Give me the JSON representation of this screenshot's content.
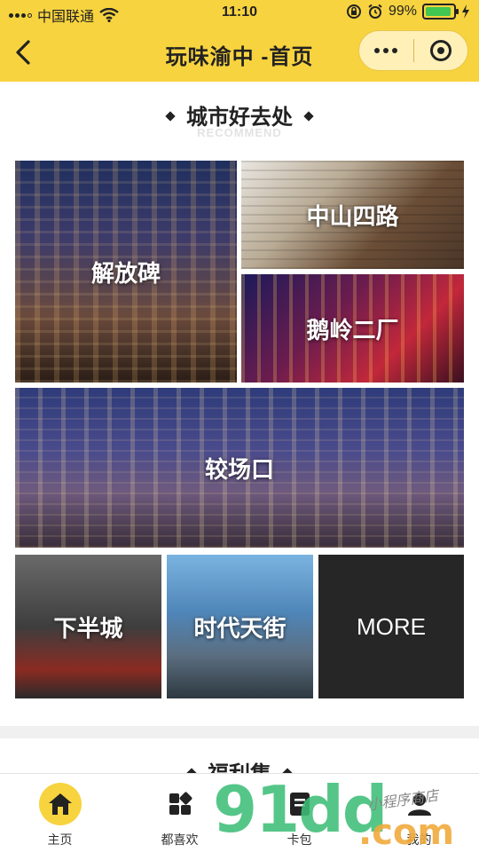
{
  "status_bar": {
    "carrier": "中国联通",
    "time": "11:10",
    "battery": "99%"
  },
  "nav": {
    "title": "玩味渝中 -首页"
  },
  "section1": {
    "title": "城市好去处",
    "subtitle": "RECOMMEND"
  },
  "tiles": [
    {
      "label": "解放碑"
    },
    {
      "label": "中山四路"
    },
    {
      "label": "鹅岭二厂"
    },
    {
      "label": "较场口"
    },
    {
      "label": "下半城"
    },
    {
      "label": "时代天街"
    },
    {
      "label": "MORE"
    }
  ],
  "section2": {
    "title": "福利集"
  },
  "tabbar": {
    "items": [
      {
        "label": "主页",
        "icon": "home-icon",
        "active": true
      },
      {
        "label": "都喜欢",
        "icon": "grid-icon",
        "active": false
      },
      {
        "label": "卡包",
        "icon": "card-icon",
        "active": false
      },
      {
        "label": "我的",
        "icon": "user-icon",
        "active": false
      }
    ]
  },
  "watermark": {
    "main": "91dd",
    "suffix": ".com",
    "signature": "小程序商店"
  },
  "colors": {
    "brand_yellow": "#f7d33f",
    "more_tile": "#262626"
  }
}
